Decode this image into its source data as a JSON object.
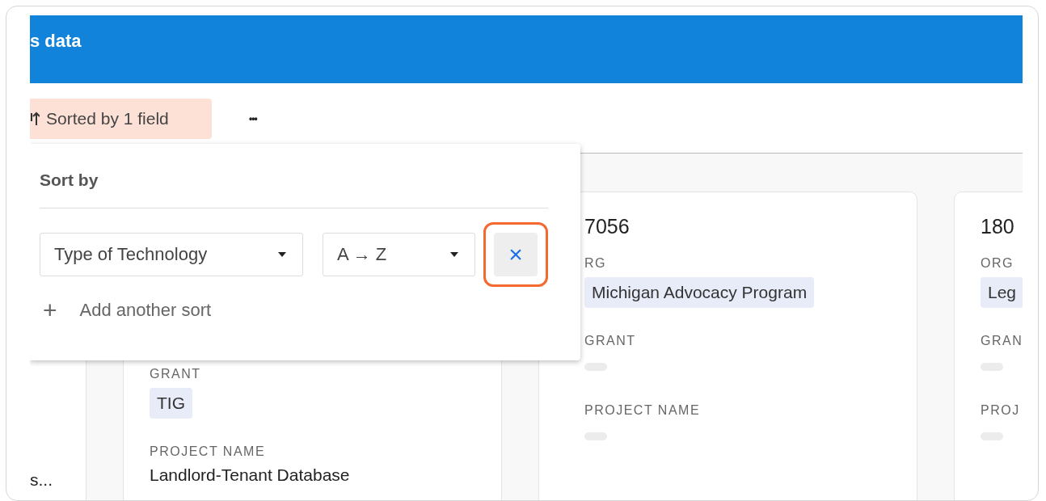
{
  "header": {
    "title": "s data"
  },
  "toolbar": {
    "sort_chip": "Sorted by 1 field",
    "more": "•••"
  },
  "sort_popup": {
    "title": "Sort by",
    "rules": [
      {
        "field": "Type of Technology",
        "order": "A → Z",
        "remove": "×",
        "highlighted": true
      }
    ],
    "add": {
      "icon": "+",
      "label": "Add another sort"
    }
  },
  "cards": [
    {
      "kind": "stub",
      "fields": [
        {
          "value": "s...",
          "kind": "text"
        }
      ]
    },
    {
      "kind": "covered",
      "fields": [
        {
          "label": "GRANT",
          "value": "TIG",
          "kind": "tag"
        },
        {
          "label": "PROJECT NAME",
          "value": "Landlord-Tenant Database",
          "kind": "text"
        }
      ]
    },
    {
      "kind": "full",
      "title": "7056",
      "fields": [
        {
          "label": "RG",
          "value": "Michigan Advocacy Program",
          "kind": "tag"
        },
        {
          "label": "GRANT",
          "kind": "empty"
        },
        {
          "label": "PROJECT NAME",
          "kind": "empty"
        }
      ]
    },
    {
      "kind": "full",
      "title": "180",
      "fields": [
        {
          "label": "ORG",
          "value": "Leg",
          "kind": "tag"
        },
        {
          "label": "GRAN",
          "kind": "empty"
        },
        {
          "label": "PROJ",
          "kind": "empty"
        }
      ]
    }
  ]
}
